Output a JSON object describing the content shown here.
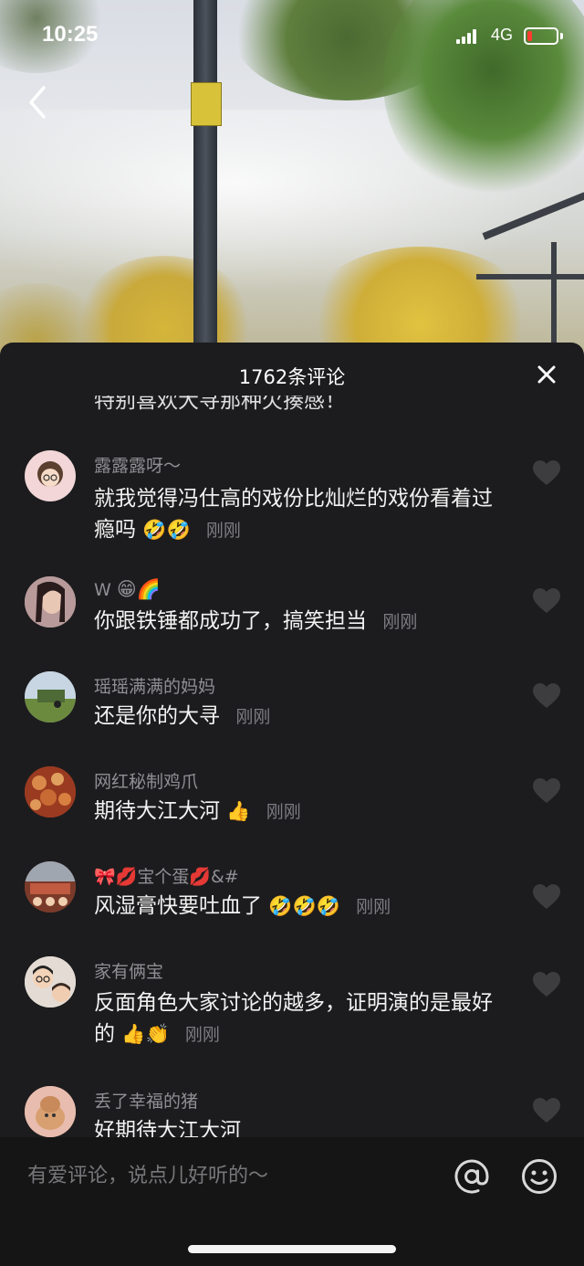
{
  "status_bar": {
    "time": "10:25",
    "network": "4G"
  },
  "panel": {
    "title": "1762条评论",
    "partial_top_text": "特别喜欢大寻那种欠揍感！"
  },
  "comments": [
    {
      "name": "露露露呀～",
      "text": "就我觉得冯仕高的戏份比灿烂的戏份看着过瘾吗",
      "emojis": "🤣🤣",
      "time": "刚刚"
    },
    {
      "name": "W",
      "name_emojis": "😁🌈",
      "text": "你跟铁锤都成功了，搞笑担当",
      "emojis": "",
      "time": "刚刚"
    },
    {
      "name": "瑶瑶满满的妈妈",
      "text": "还是你的大寻",
      "emojis": "",
      "time": "刚刚"
    },
    {
      "name": "网红秘制鸡爪",
      "text": "期待大江大河",
      "emojis": "👍",
      "time": "刚刚"
    },
    {
      "name": "🎀💋宝个蛋💋&#",
      "text": "风湿膏快要吐血了",
      "emojis": "🤣🤣🤣",
      "time": "刚刚"
    },
    {
      "name": "家有俩宝",
      "text": "反面角色大家讨论的越多，证明演的是最好的",
      "emojis": "👍👏",
      "time": "刚刚"
    },
    {
      "name": "丢了幸福的猪",
      "text": "好期待大江大河",
      "emojis": "",
      "time": ""
    }
  ],
  "input": {
    "placeholder": "有爱评论，说点儿好听的～"
  },
  "icons": {
    "back": "chevron-left-icon",
    "close": "close-icon",
    "like": "heart-icon",
    "mention": "at-icon",
    "emoji": "smiley-icon"
  },
  "colors": {
    "panel_bg": "#1c1c1e",
    "text_primary": "#f2f2f2",
    "text_secondary": "#8f8f94",
    "battery_low": "#ff3b30"
  }
}
